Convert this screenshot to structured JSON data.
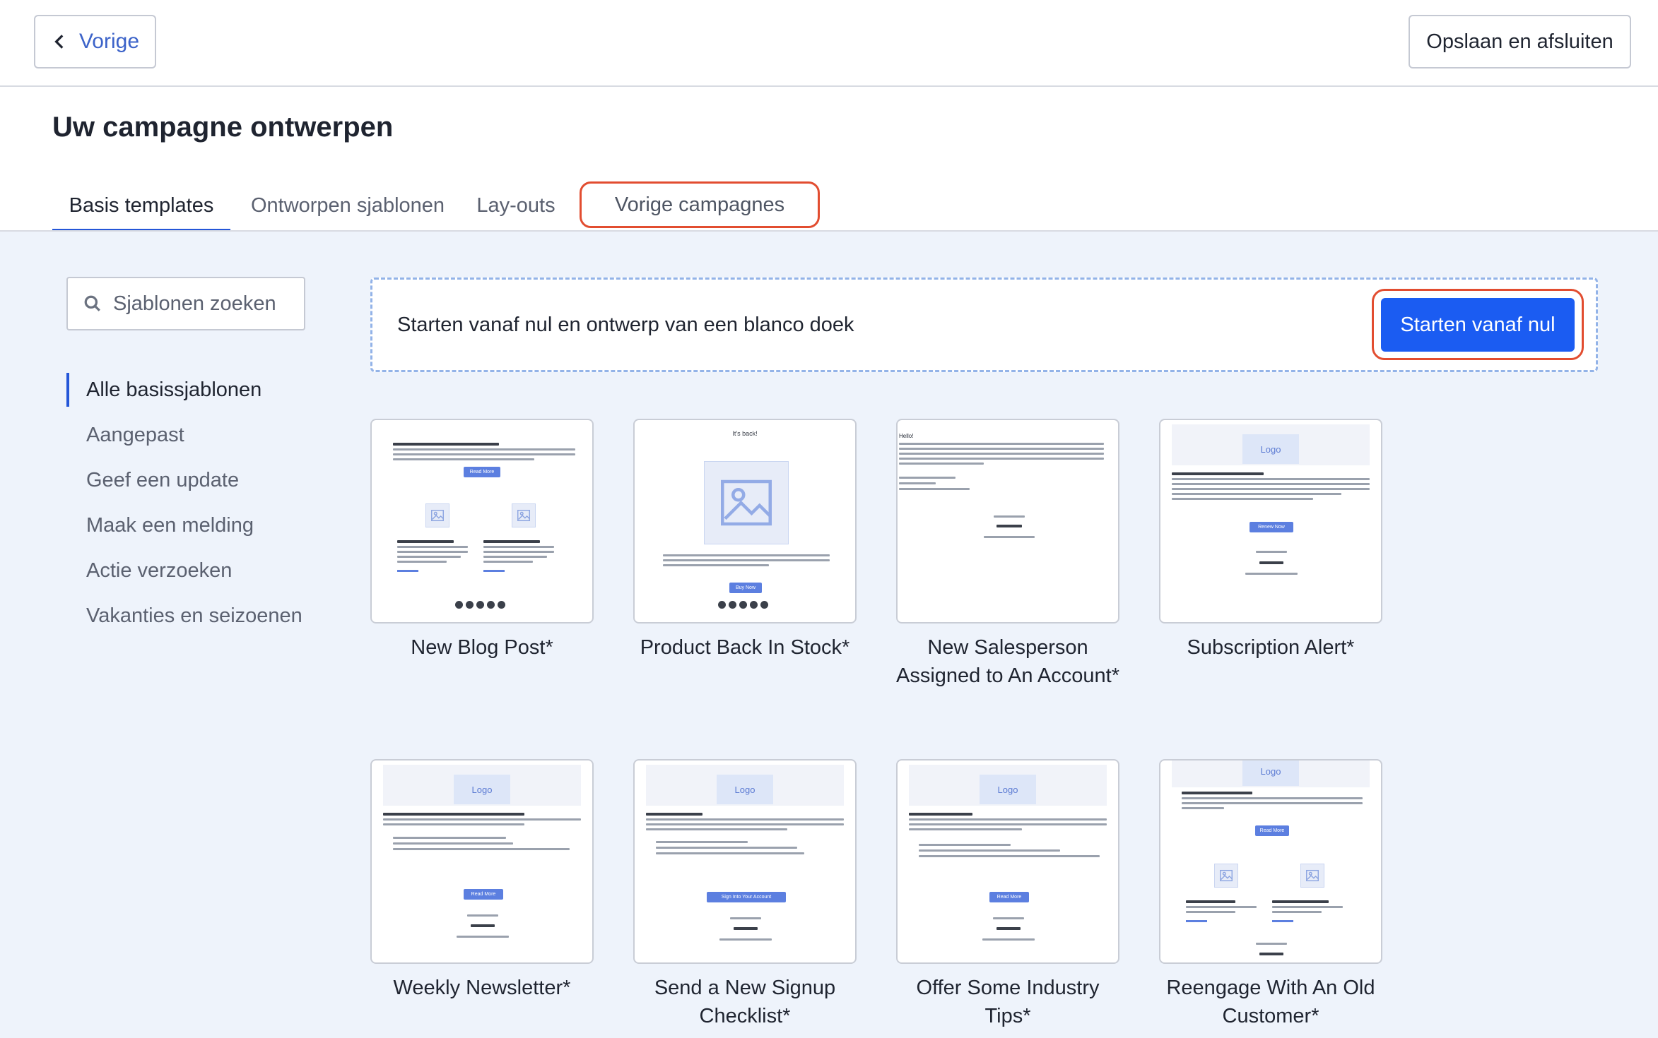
{
  "topbar": {
    "back_label": "Vorige",
    "save_label": "Opslaan en afsluiten"
  },
  "header": {
    "title": "Uw campagne ontwerpen",
    "tabs": [
      {
        "label": "Basis templates",
        "active": true
      },
      {
        "label": "Ontworpen sjablonen",
        "active": false
      },
      {
        "label": "Lay-outs",
        "active": false
      },
      {
        "label": "Vorige campagnes",
        "active": false,
        "highlighted": true
      }
    ]
  },
  "search": {
    "placeholder": "Sjablonen zoeken"
  },
  "sidebar": {
    "items": [
      {
        "label": "Alle basissjablonen",
        "active": true
      },
      {
        "label": "Aangepast",
        "active": false
      },
      {
        "label": "Geef een update",
        "active": false
      },
      {
        "label": "Maak een melding",
        "active": false
      },
      {
        "label": "Actie verzoeken",
        "active": false
      },
      {
        "label": "Vakanties en seizoenen",
        "active": false
      }
    ]
  },
  "blank": {
    "text": "Starten vanaf nul en ontwerp van een blanco doek",
    "button": "Starten vanaf nul"
  },
  "templates": [
    {
      "title": "New Blog Post*"
    },
    {
      "title": "Product Back In Stock*"
    },
    {
      "title": "New Salesperson Assigned to An Account*"
    },
    {
      "title": "Subscription Alert*"
    },
    {
      "title": "Weekly Newsletter*"
    },
    {
      "title": "Send a New Signup Checklist*"
    },
    {
      "title": "Offer Some Industry Tips*"
    },
    {
      "title": "Reengage With An Old Customer*"
    }
  ],
  "thumbs": {
    "logo": "Logo",
    "read_more": "Read More",
    "buy_now": "Buy Now",
    "renew_now": "Renew Now",
    "sign_into": "Sign Into Your Account",
    "its_back": "It's back!",
    "hello": "Hello!"
  },
  "colors": {
    "accent": "#1b5cf2",
    "highlight": "#e24d30",
    "content_bg": "#eef3fb"
  }
}
